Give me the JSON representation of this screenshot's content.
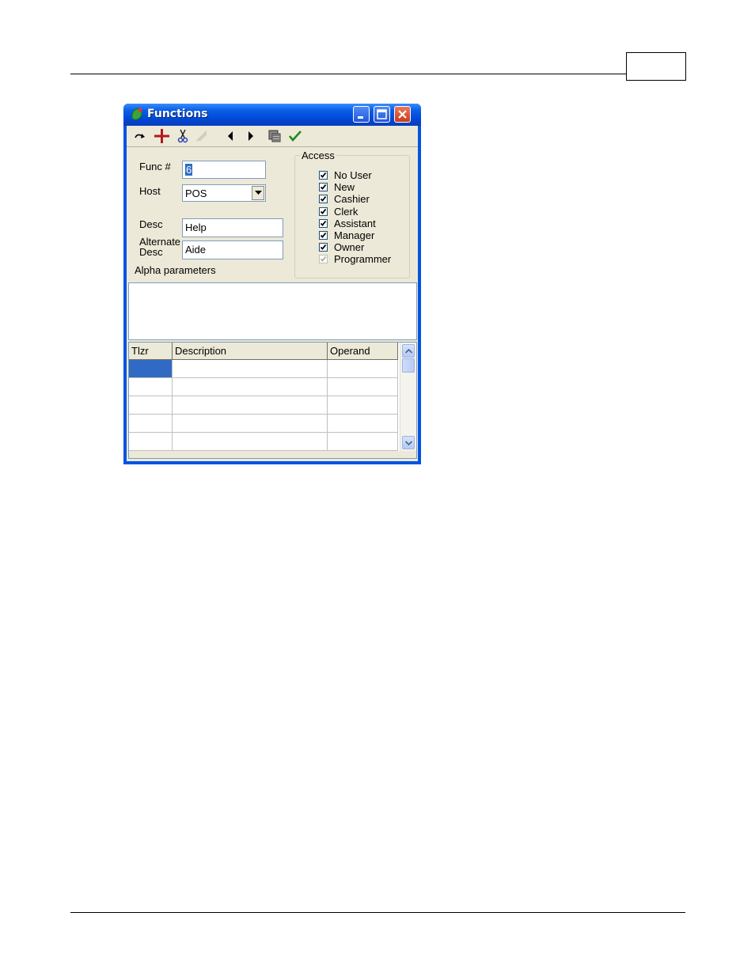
{
  "window": {
    "title": "Functions"
  },
  "toolbar": {
    "icons": [
      "redo-icon",
      "add-icon",
      "cut-icon",
      "delete-icon",
      "prev-icon",
      "next-icon",
      "copy-icon",
      "confirm-icon"
    ]
  },
  "form": {
    "func_label": "Func #",
    "func_value": "6",
    "host_label": "Host",
    "host_value": "POS",
    "desc_label": "Desc",
    "desc_value": "Help",
    "alt_desc_label_line1": "Alternate",
    "alt_desc_label_line2": "Desc",
    "alt_desc_value": "Aide",
    "alpha_label": "Alpha parameters"
  },
  "access": {
    "title": "Access",
    "items": [
      {
        "label": "No User",
        "checked": true,
        "enabled": true
      },
      {
        "label": "New",
        "checked": true,
        "enabled": true
      },
      {
        "label": "Cashier",
        "checked": true,
        "enabled": true
      },
      {
        "label": "Clerk",
        "checked": true,
        "enabled": true
      },
      {
        "label": "Assistant",
        "checked": true,
        "enabled": true
      },
      {
        "label": "Manager",
        "checked": true,
        "enabled": true
      },
      {
        "label": "Owner",
        "checked": true,
        "enabled": true
      },
      {
        "label": "Programmer",
        "checked": true,
        "enabled": false
      }
    ]
  },
  "grid": {
    "columns": [
      "Tlzr",
      "Description",
      "Operand"
    ]
  },
  "colors": {
    "titlebar": "#0054e3",
    "selection": "#316ac5",
    "client_bg": "#ece9d8"
  }
}
